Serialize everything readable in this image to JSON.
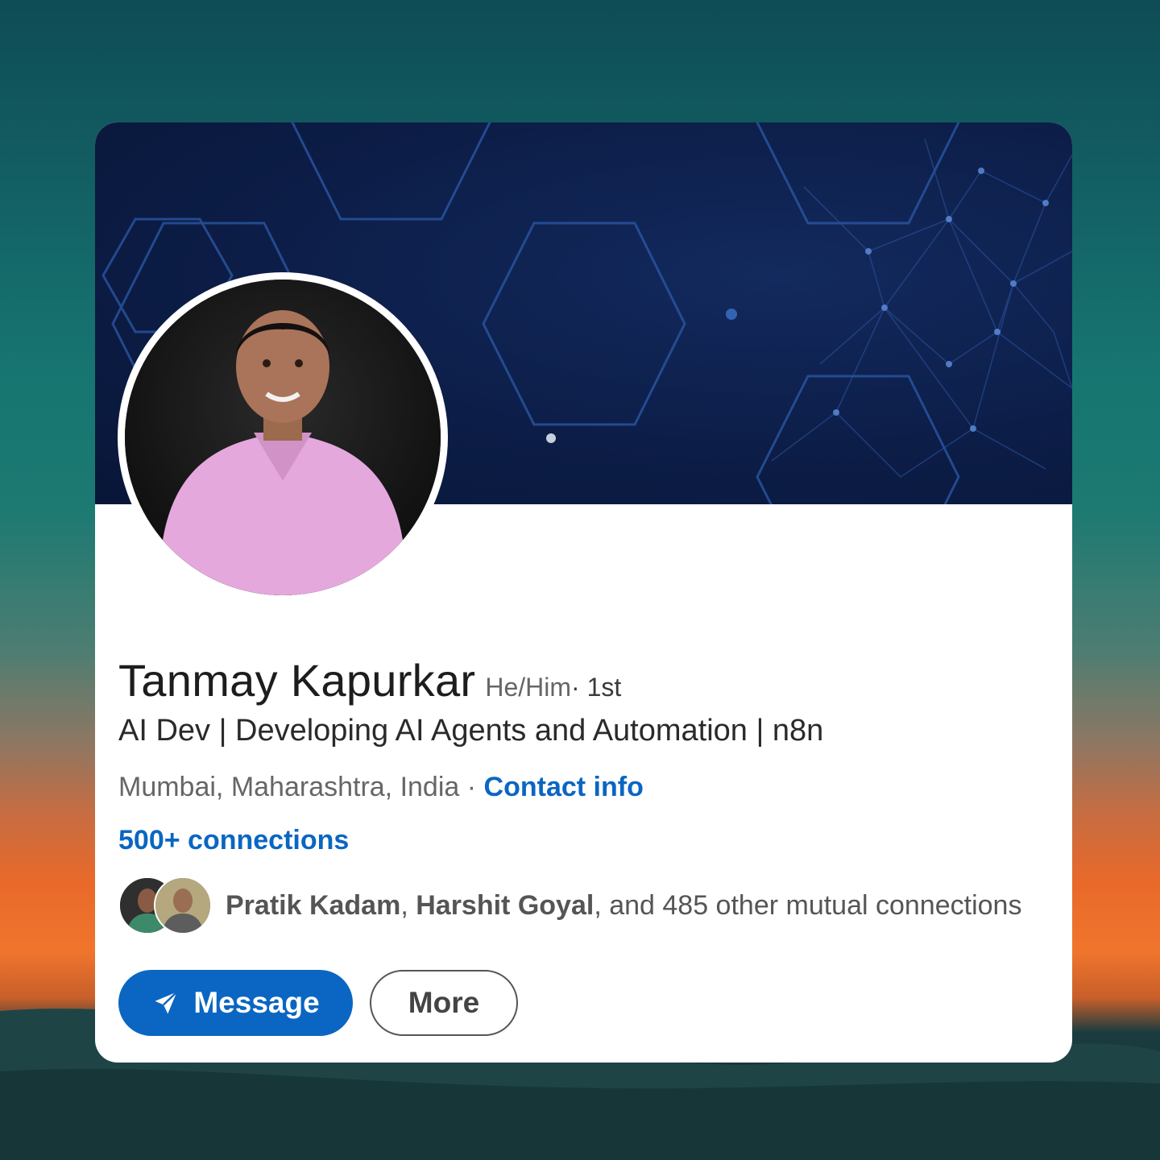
{
  "profile": {
    "name": "Tanmay Kapurkar",
    "pronouns": "He/Him",
    "degree": " · 1st",
    "headline": "AI Dev | Developing AI Agents and Automation | n8n",
    "location": "Mumbai, Maharashtra, India",
    "location_separator": " · ",
    "contact_label": "Contact info",
    "connections": "500+ connections",
    "mutual": {
      "name1": "Pratik Kadam",
      "separator": ", ",
      "name2": "Harshit Goyal",
      "rest": ", and 485 other mutual connections"
    }
  },
  "actions": {
    "message_label": "Message",
    "more_label": "More"
  },
  "colors": {
    "accent": "#0a66c2",
    "banner": "#0c1d47",
    "card": "#ffffff"
  },
  "icons": {
    "message": "paper-plane-icon"
  }
}
